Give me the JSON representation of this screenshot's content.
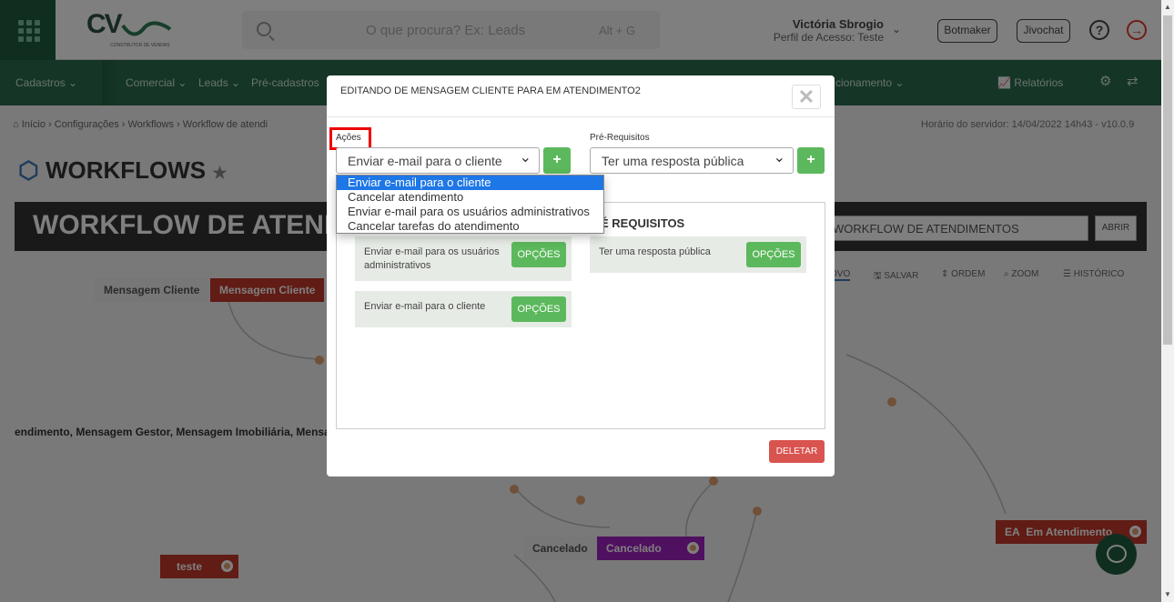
{
  "header": {
    "logo_text": "CV",
    "logo_sub": "CONSTRUTOR DE VENDAS",
    "search_placeholder": "O que procura? Ex: Leads",
    "search_shortcut": "Alt + G",
    "user_name": "Victória Sbrogio",
    "user_role": "Perfil de Acesso: Teste",
    "buttons": [
      "Botmaker",
      "Jivochat"
    ]
  },
  "nav": {
    "items": [
      "Cadastros",
      "Comercial",
      "Leads",
      "Pré-cadastros",
      "cionamento",
      "Relatórios"
    ]
  },
  "breadcrumb": "Início  ›  Configurações  ›  Workflows  ›  Workflow de atendi",
  "server_time": "Horário do servidor: 14/04/2022 14h43 - v10.0.9",
  "page_title": "WORKFLOWS",
  "banner": {
    "title": "WORKFLOW DE ATEND",
    "select_value": "WORKFLOW DE ATENDIMENTOS",
    "open_label": "ABRIR"
  },
  "toolbar": [
    "OVO",
    "SALVAR",
    "ORDEM",
    "ZOOM",
    "HISTÓRICO"
  ],
  "canvas": {
    "node_1": "Mensagem Cliente",
    "node_2": "Mensagem Cliente",
    "long_label": "endimento, Mensagem Gestor, Mensagem Imobiliária, Mensa",
    "cancel_1": "Cancelado",
    "cancel_2": "Cancelado",
    "teste": "teste",
    "ea_prefix": "EA",
    "em_atendimento": "Em Atendimento"
  },
  "modal": {
    "title": "EDITANDO DE MENSAGEM CLIENTE PARA EM ATENDIMENTO2",
    "close": "✕",
    "acoes_label": "Ações",
    "acoes_value": "Enviar e-mail para o cliente",
    "prereq_label": "Pré-Requisitos",
    "prereq_value": "Ter uma resposta pública",
    "plus": "+",
    "prereq_section_title": "É REQUISITOS",
    "action_cards": [
      {
        "text": "Enviar e-mail para os usuários administrativos",
        "button": "OPÇÕES"
      },
      {
        "text": "Enviar e-mail para o cliente",
        "button": "OPÇÕES"
      }
    ],
    "prereq_cards": [
      {
        "text": "Ter uma resposta pública",
        "button": "OPÇÕES"
      }
    ],
    "delete": "DELETAR"
  },
  "dropdown": {
    "options": [
      "Enviar e-mail para o cliente",
      "Cancelar atendimento",
      "Enviar e-mail para os usuários administrativos",
      "Cancelar tarefas do atendimento"
    ],
    "selected_index": 0
  }
}
